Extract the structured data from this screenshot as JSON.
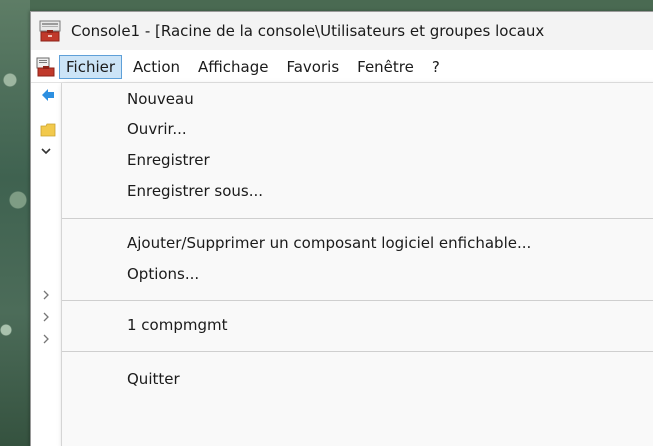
{
  "window": {
    "title": "Console1 - [Racine de la console\\Utilisateurs et groupes locaux"
  },
  "menubar": {
    "items": [
      {
        "label": "Fichier",
        "active": true
      },
      {
        "label": "Action"
      },
      {
        "label": "Affichage"
      },
      {
        "label": "Favoris"
      },
      {
        "label": "Fenêtre"
      },
      {
        "label": "?"
      }
    ]
  },
  "file_menu": {
    "items": [
      {
        "label": "Nouveau"
      },
      {
        "label": "Ouvrir..."
      },
      {
        "label": "Enregistrer"
      },
      {
        "label": "Enregistrer sous..."
      },
      {
        "label": "Ajouter/Supprimer un composant logiciel enfichable..."
      },
      {
        "label": "Options..."
      },
      {
        "label": "1 compmgmt"
      },
      {
        "label": "Quitter"
      }
    ]
  },
  "colors": {
    "menu_highlight_bg": "#cce4f7",
    "menu_highlight_border": "#5fa0d8",
    "dropdown_bg": "#f9f9f9",
    "titlebar_bg": "#f3f3f3",
    "icon_red": "#c0392b"
  },
  "icons": {
    "app": "mmc-console-icon",
    "document": "console-document-icon",
    "back": "back-arrow-icon",
    "folder": "folder-icon"
  }
}
